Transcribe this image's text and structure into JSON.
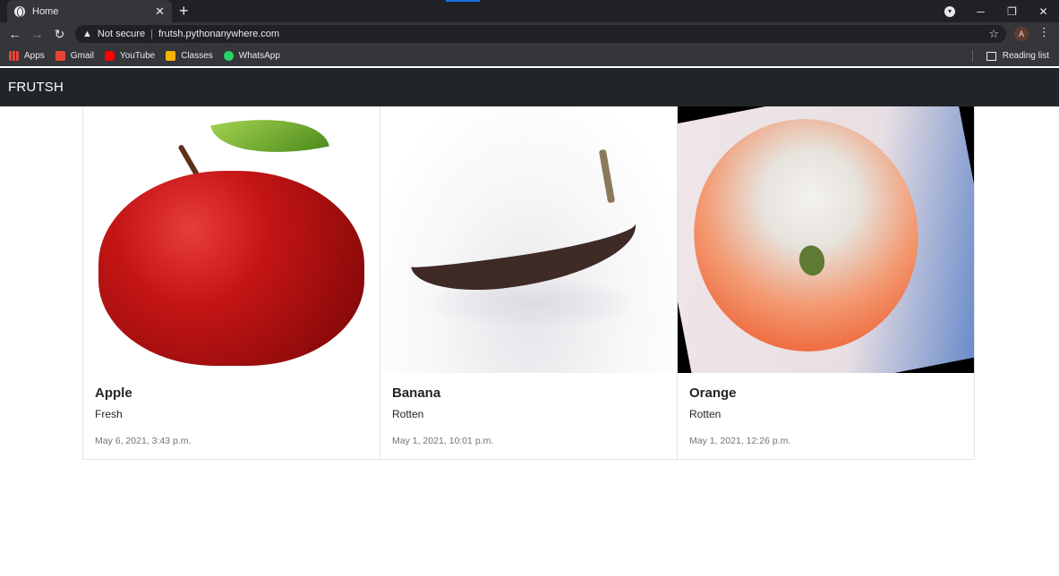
{
  "browser": {
    "tab_title": "Home",
    "tab_close": "✕",
    "new_tab": "+",
    "security_label": "Not secure",
    "url": "frutsh.pythonanywhere.com",
    "profile_initial": "A",
    "bookmarks": [
      "Apps",
      "Gmail",
      "YouTube",
      "Classes",
      "WhatsApp"
    ],
    "reading_list": "Reading list"
  },
  "site": {
    "brand": "FRUTSH"
  },
  "cards": [
    {
      "name": "Apple",
      "status": "Fresh",
      "date": "May 6, 2021, 3:43 p.m."
    },
    {
      "name": "Banana",
      "status": "Rotten",
      "date": "May 1, 2021, 10:01 p.m."
    },
    {
      "name": "Orange",
      "status": "Rotten",
      "date": "May 1, 2021, 12:26 p.m."
    }
  ],
  "colors": {
    "navbar_bg": "#212529",
    "chrome_bg": "#35363a",
    "tabstrip_bg": "#202124"
  }
}
